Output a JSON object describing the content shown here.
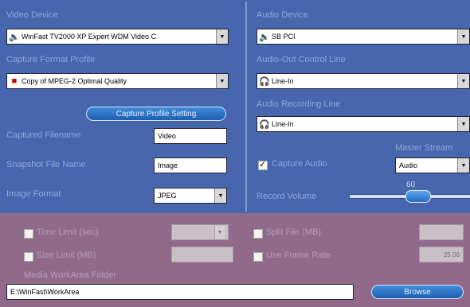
{
  "video": {
    "device_label": "Video Device",
    "device_value": "WinFast TV2000 XP Expert WDM Video C",
    "profile_label": "Capture Format Profile",
    "profile_value": "Copy of MPEG-2 Optimal Quality",
    "profile_button": "Capture Profile Setting",
    "filename_label": "Captured Filename",
    "filename_value": "Video",
    "snapshot_label": "Snapshot File Name",
    "snapshot_value": "Image",
    "format_label": "Image Format",
    "format_value": "JPEG"
  },
  "audio": {
    "device_label": "Audio Device",
    "device_value": "SB PCI",
    "out_label": "Audio-Out Control Line",
    "out_value": "Line-In",
    "rec_label": "Audio Recording Line",
    "rec_value": "Line-In",
    "capture_label": "Capture Audio",
    "capture_checked": true,
    "master_label": "Master Stream",
    "master_value": "Audio",
    "volume_label": "Record Volume",
    "volume_value": "60"
  },
  "limits": {
    "time_label": "Time Limit (sec)",
    "size_label": "Size Limit (MB)",
    "split_label": "Split File (MB)",
    "framerate_label": "Use Frame Rate",
    "framerate_value": "25.00",
    "folder_label": "Media WorkArea Folder",
    "folder_value": "E:\\WinFast\\WorkArea",
    "browse_label": "Browse"
  }
}
